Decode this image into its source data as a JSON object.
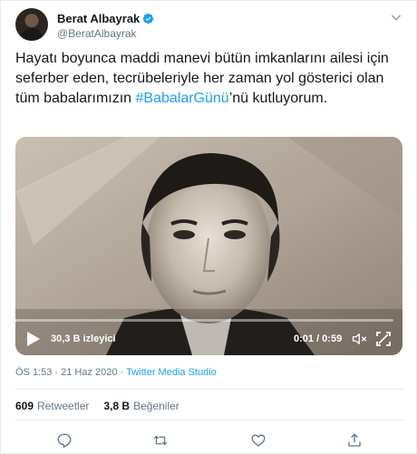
{
  "user": {
    "display_name": "Berat Albayrak",
    "handle": "@BeratAlbayrak",
    "verified": true
  },
  "tweet": {
    "text_before": "Hayatı boyunca maddi manevi bütün imkanlarını ailesi için seferber eden, tecrübeleriyle her zaman yol gösterici olan tüm babalarımızın ",
    "hashtag": "#BabalarGünü",
    "text_after": "’nü kutluyorum."
  },
  "video": {
    "views": "30,3 B izleyici",
    "time": "0:01 / 0:59",
    "progress": 0.02
  },
  "meta": {
    "timestamp": "ÖS 1:53 · 21 Haz 2020",
    "separator": " · ",
    "source": "Twitter Media Studio"
  },
  "stats": {
    "retweets_count": "609",
    "retweets_label": "Retweetler",
    "likes_count": "3,8 B",
    "likes_label": "Beğeniler"
  },
  "colors": {
    "accent": "#1da1f2",
    "text": "#14171a",
    "muted": "#657786",
    "border": "#e6ecf0"
  }
}
